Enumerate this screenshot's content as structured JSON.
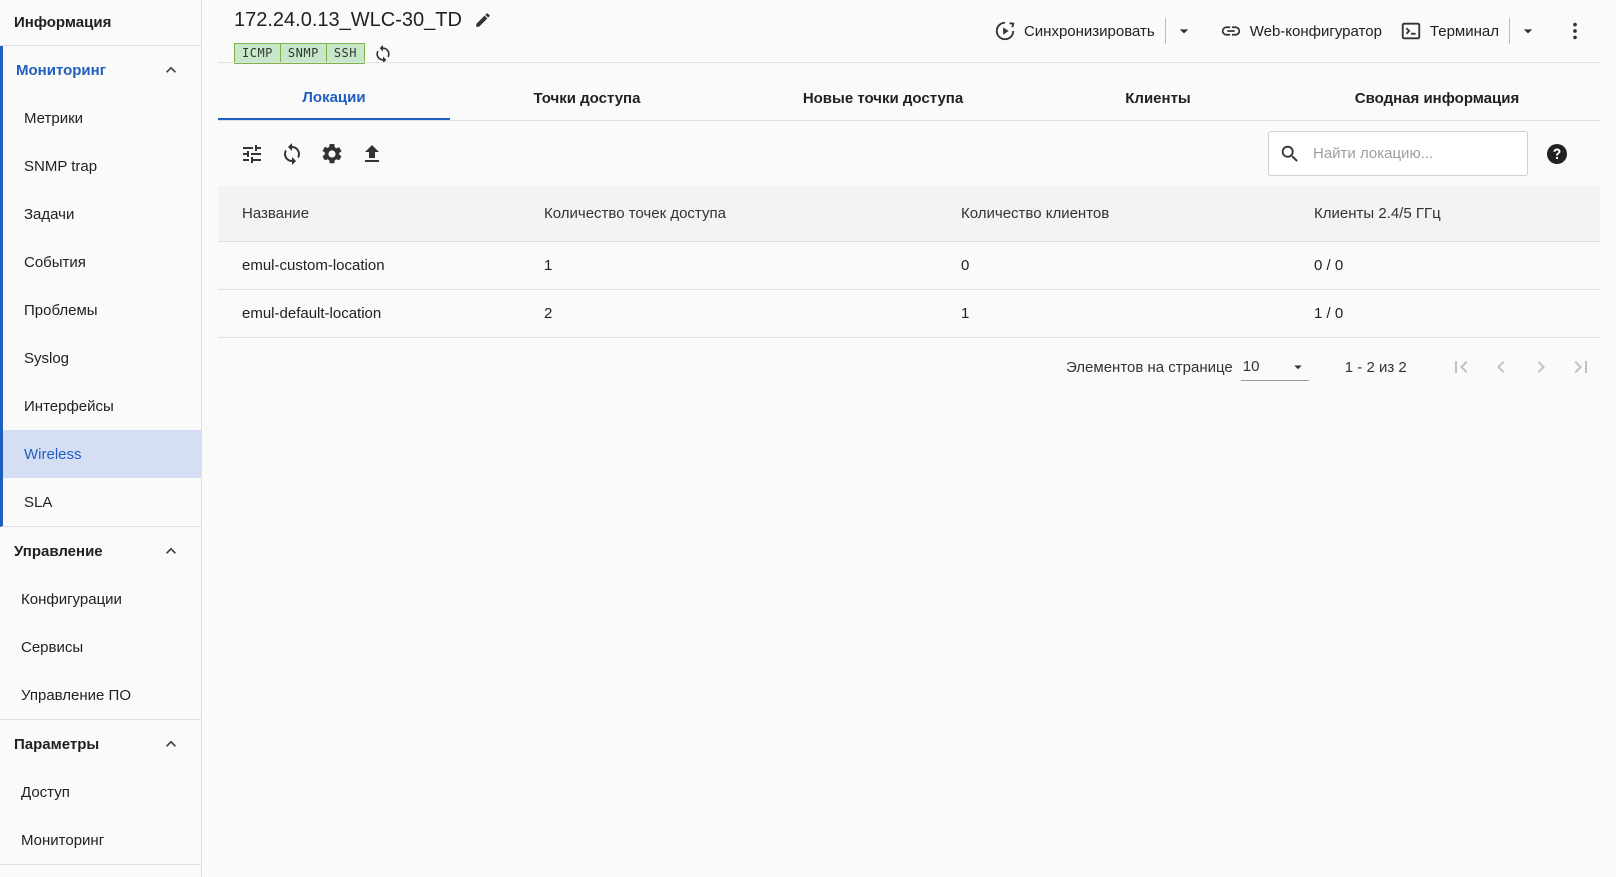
{
  "sidebar": {
    "header": "Информация",
    "monitoring": {
      "title": "Мониторинг",
      "items": [
        "Метрики",
        "SNMP trap",
        "Задачи",
        "События",
        "Проблемы",
        "Syslog",
        "Интерфейсы",
        "Wireless",
        "SLA"
      ],
      "active": "Wireless"
    },
    "management": {
      "title": "Управление",
      "items": [
        "Конфигурации",
        "Сервисы",
        "Управление ПО"
      ]
    },
    "params": {
      "title": "Параметры",
      "items": [
        "Доступ",
        "Мониторинг"
      ]
    }
  },
  "device": {
    "title": "172.24.0.13_WLC-30_TD",
    "badges": [
      "ICMP",
      "SNMP",
      "SSH"
    ]
  },
  "actions": {
    "sync": "Синхронизировать",
    "web": "Web-конфигуратор",
    "terminal": "Терминал"
  },
  "tabs": [
    {
      "label": "Локации",
      "active": true
    },
    {
      "label": "Точки доступа",
      "active": false
    },
    {
      "label": "Новые точки доступа",
      "active": false
    },
    {
      "label": "Клиенты",
      "active": false
    },
    {
      "label": "Сводная информация",
      "active": false
    }
  ],
  "search": {
    "placeholder": "Найти локацию..."
  },
  "table": {
    "columns": [
      "Название",
      "Количество точек доступа",
      "Количество клиентов",
      "Клиенты 2.4/5 ГГц"
    ],
    "rows": [
      [
        "emul-custom-location",
        "1",
        "0",
        "0 / 0"
      ],
      [
        "emul-default-location",
        "2",
        "1",
        "1 / 0"
      ]
    ]
  },
  "pagination": {
    "per_page_label": "Элементов на странице",
    "per_page_value": "10",
    "range": "1 - 2 из 2"
  },
  "colors": {
    "accent": "#1f5fbf",
    "active_bg": "#d6def3",
    "badge_bg": "#c8e6c9"
  }
}
